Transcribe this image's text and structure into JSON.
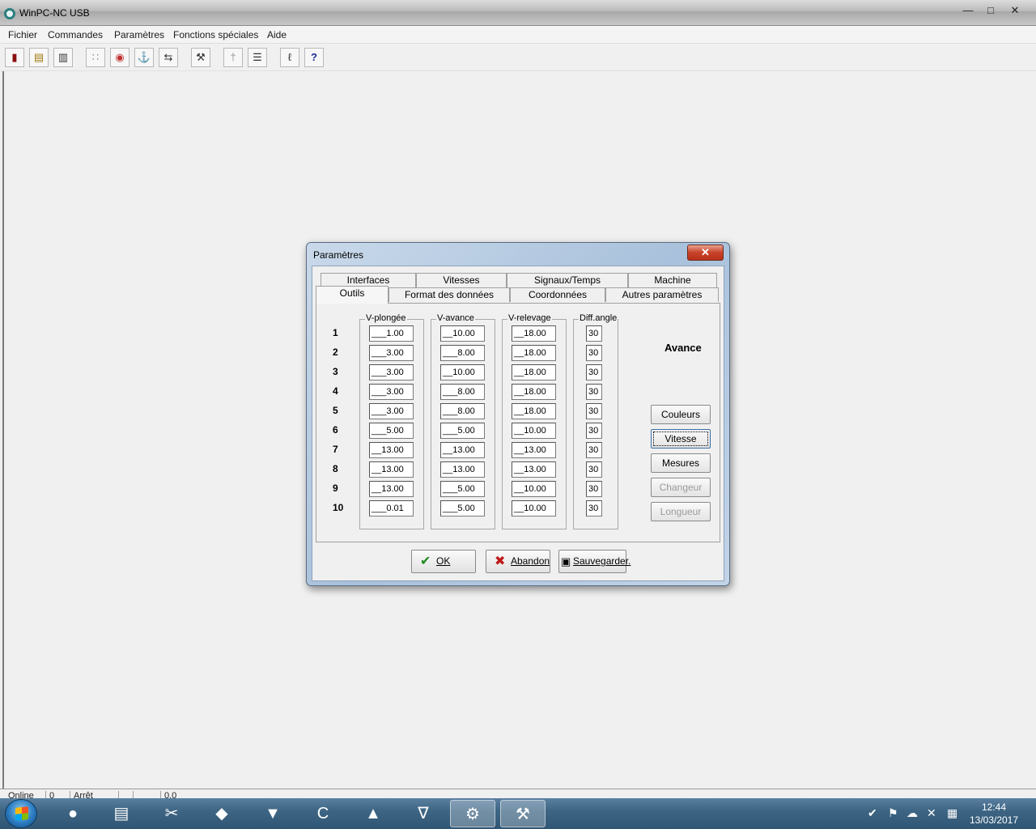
{
  "window": {
    "title": "WinPC-NC USB",
    "controls": [
      "—",
      "□",
      "✕"
    ]
  },
  "menu": [
    "Fichier",
    "Commandes",
    "Paramètres",
    "Fonctions spéciales",
    "Aide"
  ],
  "toolbar": [
    {
      "name": "exit-icon",
      "glyph": "▮"
    },
    {
      "name": "open-folder-icon",
      "glyph": "▤"
    },
    {
      "name": "document-icon",
      "glyph": "▥"
    },
    {
      "name": "dots-grid-icon",
      "glyph": "∷"
    },
    {
      "name": "color-wheel-icon",
      "glyph": "◉"
    },
    {
      "name": "anchor-icon",
      "glyph": "⚓"
    },
    {
      "name": "arrows-icon",
      "glyph": "⇆"
    },
    {
      "name": "tools-icon",
      "glyph": "⚒"
    },
    {
      "name": "probe-icon",
      "glyph": "†"
    },
    {
      "name": "list-icon",
      "glyph": "☰"
    },
    {
      "name": "link-icon",
      "glyph": "ℓ"
    },
    {
      "name": "help-icon",
      "glyph": "?"
    }
  ],
  "status": [
    "Online",
    "0",
    "Arrêt",
    "",
    "0.0"
  ],
  "dialog": {
    "title": "Paramètres",
    "close": "✕",
    "tabs_row1": [
      "Interfaces",
      "Vitesses",
      "Signaux/Temps",
      "Machine"
    ],
    "tabs_row2": [
      "Outils",
      "Format des données",
      "Coordonnées",
      "Autres paramètres"
    ],
    "active_tab": "Outils",
    "columns": [
      "V-plongée",
      "V-avance",
      "V-relevage",
      "Diff.angle"
    ],
    "rows": [
      {
        "num": "1",
        "plongee": "___1.00",
        "avance": "__10.00",
        "relevage": "__18.00",
        "angle": "30"
      },
      {
        "num": "2",
        "plongee": "___3.00",
        "avance": "___8.00",
        "relevage": "__18.00",
        "angle": "30"
      },
      {
        "num": "3",
        "plongee": "___3.00",
        "avance": "__10.00",
        "relevage": "__18.00",
        "angle": "30"
      },
      {
        "num": "4",
        "plongee": "___3.00",
        "avance": "___8.00",
        "relevage": "__18.00",
        "angle": "30"
      },
      {
        "num": "5",
        "plongee": "___3.00",
        "avance": "___8.00",
        "relevage": "__18.00",
        "angle": "30"
      },
      {
        "num": "6",
        "plongee": "___5.00",
        "avance": "___5.00",
        "relevage": "__10.00",
        "angle": "30"
      },
      {
        "num": "7",
        "plongee": "__13.00",
        "avance": "__13.00",
        "relevage": "__13.00",
        "angle": "30"
      },
      {
        "num": "8",
        "plongee": "__13.00",
        "avance": "__13.00",
        "relevage": "__13.00",
        "angle": "30"
      },
      {
        "num": "9",
        "plongee": "__13.00",
        "avance": "___5.00",
        "relevage": "__10.00",
        "angle": "30"
      },
      {
        "num": "10",
        "plongee": "___0.01",
        "avance": "___5.00",
        "relevage": "__10.00",
        "angle": "30"
      }
    ],
    "side_label": "Avance",
    "side_buttons": [
      {
        "label": "Couleurs",
        "enabled": true
      },
      {
        "label": "Vitesse",
        "enabled": true,
        "focused": true
      },
      {
        "label": "Mesures",
        "enabled": true
      },
      {
        "label": "Changeur",
        "enabled": false
      },
      {
        "label": "Longueur",
        "enabled": false
      }
    ],
    "buttons": {
      "ok": "OK",
      "cancel": "Abandon",
      "save": "Sauvegarder."
    }
  },
  "taskbar": {
    "apps": [
      {
        "name": "chrome-icon",
        "glyph": "●"
      },
      {
        "name": "explorer-folder-icon",
        "glyph": "▤"
      },
      {
        "name": "app-cut-icon",
        "glyph": "✂"
      },
      {
        "name": "inkscape-icon",
        "glyph": "◆"
      },
      {
        "name": "app-arrow-icon",
        "glyph": "▼"
      },
      {
        "name": "app-c-icon",
        "glyph": "C"
      },
      {
        "name": "app-triangle-icon",
        "glyph": "▲"
      },
      {
        "name": "app-v-icon",
        "glyph": "∇"
      },
      {
        "name": "winpc-nc-icon",
        "glyph": "⚙"
      },
      {
        "name": "app-tool-icon",
        "glyph": "⚒"
      }
    ],
    "time": "12:44",
    "date": "13/03/2017"
  }
}
